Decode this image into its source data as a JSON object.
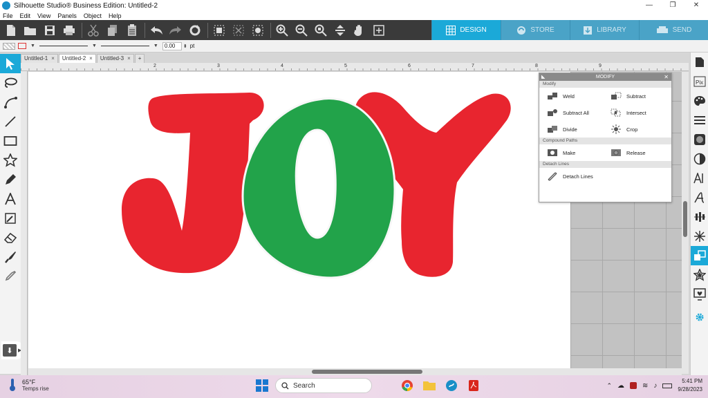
{
  "window": {
    "title": "Silhouette Studio® Business Edition: Untitled-2",
    "minimize": "—",
    "maximize": "❐",
    "close": "✕"
  },
  "menu": [
    "File",
    "Edit",
    "View",
    "Panels",
    "Object",
    "Help"
  ],
  "nav_tabs": [
    {
      "label": "DESIGN",
      "icon": "grid-icon",
      "active": true
    },
    {
      "label": "STORE",
      "icon": "store-icon",
      "active": false
    },
    {
      "label": "LIBRARY",
      "icon": "library-icon",
      "active": false
    },
    {
      "label": "SEND",
      "icon": "send-icon",
      "active": false
    }
  ],
  "line_options": {
    "width_value": "0.00",
    "unit": "pt"
  },
  "doc_tabs": [
    {
      "label": "Untitled-1",
      "active": false
    },
    {
      "label": "Untitled-2",
      "active": true
    },
    {
      "label": "Untitled-3",
      "active": false
    }
  ],
  "add_tab": "+",
  "close_glyph": "×",
  "ruler_numbers": [
    "2",
    "3",
    "4",
    "5",
    "6",
    "7",
    "8",
    "9"
  ],
  "design": {
    "text": "JOY",
    "colors": {
      "J": "#e8252f",
      "O": "#22a34a",
      "Y": "#e8252f"
    }
  },
  "modify_panel": {
    "title": "MODIFY",
    "collapse": "◣",
    "close": "✕",
    "sections": {
      "modify": "Modify",
      "compound": "Compound Paths",
      "detach": "Detach Lines"
    },
    "items": {
      "weld": "Weld",
      "subtract": "Subtract",
      "subtract_all": "Subtract All",
      "intersect": "Intersect",
      "divide": "Divide",
      "crop": "Crop",
      "make": "Make",
      "release": "Release",
      "detach_lines": "Detach Lines"
    }
  },
  "taskbar": {
    "temperature": "65°F",
    "weather": "Temps rise",
    "search": "Search",
    "time": "5:41 PM",
    "date": "9/28/2023"
  },
  "accent_color": "#1ba9d8"
}
